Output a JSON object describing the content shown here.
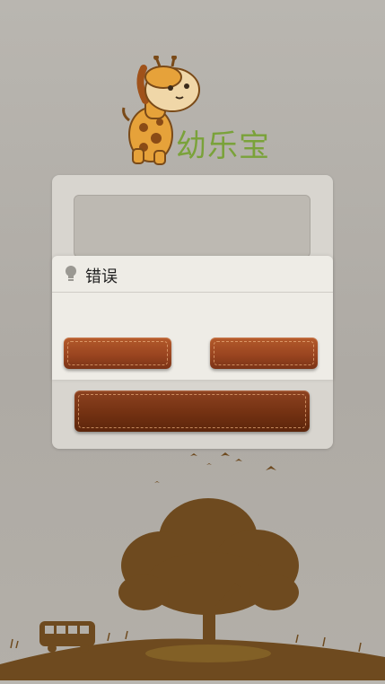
{
  "app": {
    "name": "幼乐宝"
  },
  "login": {
    "username_value": ""
  },
  "dialog": {
    "title": "错误",
    "message": "",
    "left_button_label": "",
    "right_button_label": ""
  },
  "login_button_label": "",
  "icons": {
    "logo": "giraffe-mascot-icon",
    "dialog": "lightbulb-icon"
  },
  "colors": {
    "brand_green": "#7aa23a",
    "leather_brown": "#9a4520",
    "silhouette": "#6e4a1f"
  }
}
